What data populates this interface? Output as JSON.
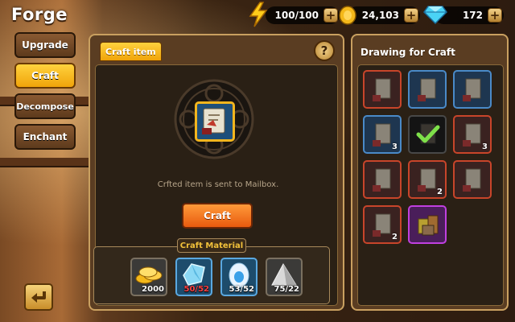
{
  "header": {
    "title": "Forge"
  },
  "resources": {
    "stamina": {
      "value": "100/100",
      "icon": "lightning-icon"
    },
    "gold": {
      "value": "24,103",
      "icon": "gold-coin-icon"
    },
    "gems": {
      "value": "172",
      "icon": "diamond-icon"
    },
    "plus_label": "+"
  },
  "sidebar": {
    "tabs": [
      {
        "label": "Upgrade"
      },
      {
        "label": "Craft"
      },
      {
        "label": "Decompose"
      },
      {
        "label": "Enchant"
      }
    ],
    "active": "Craft"
  },
  "craft_panel": {
    "tab_label": "Craft item",
    "help_label": "?",
    "info_text": "Crfted item is sent to Mailbox.",
    "craft_button": "Craft",
    "materials_title": "Craft Material",
    "materials": [
      {
        "name": "gold-coins",
        "count": "2000",
        "insufficient": false
      },
      {
        "name": "blue-crystal",
        "count": "50/52",
        "insufficient": true
      },
      {
        "name": "blue-egg-stone",
        "count": "53/52",
        "insufficient": false
      },
      {
        "name": "silver-ore",
        "count": "75/22",
        "insufficient": false
      }
    ]
  },
  "drawings_panel": {
    "title": "Drawing for Craft",
    "slots": [
      {
        "frame": "red",
        "count": ""
      },
      {
        "frame": "blue",
        "count": ""
      },
      {
        "frame": "blue",
        "count": ""
      },
      {
        "frame": "blue",
        "count": "3"
      },
      {
        "frame": "selected",
        "count": ""
      },
      {
        "frame": "red",
        "count": "3"
      },
      {
        "frame": "red",
        "count": ""
      },
      {
        "frame": "red",
        "count": "2"
      },
      {
        "frame": "red",
        "count": ""
      },
      {
        "frame": "red",
        "count": "2"
      },
      {
        "frame": "purple",
        "count": ""
      }
    ]
  },
  "colors": {
    "accent_yellow": "#f0a40a",
    "craft_orange": "#e85a0e",
    "insufficient_red": "#ff4040"
  }
}
